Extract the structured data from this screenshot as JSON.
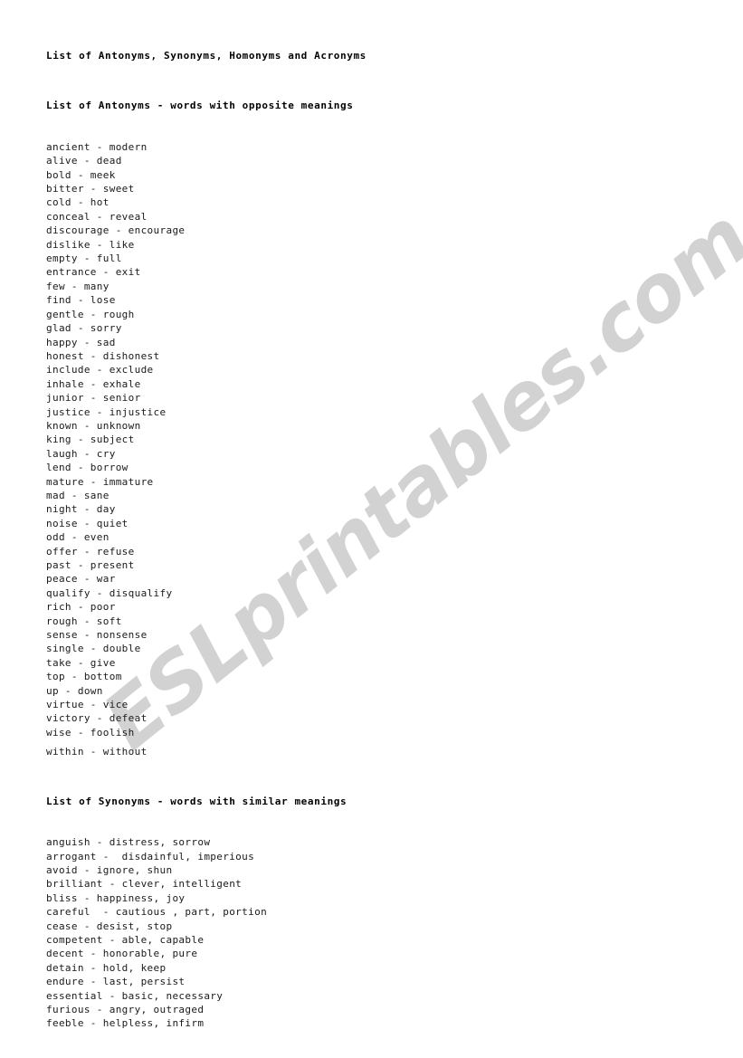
{
  "document": {
    "title": "List of Antonyms, Synonyms, Homonyms and Acronyms",
    "watermark": "ESLprintables.com",
    "colors": {
      "background": "#ffffff",
      "text": "#1a1a1a",
      "heading": "#000000",
      "watermark": "#d2d2d2"
    }
  },
  "sections": [
    {
      "heading": "List of Antonyms - words with opposite meanings",
      "entries": [
        "ancient - modern",
        "alive - dead",
        "bold - meek",
        "bitter - sweet",
        "cold - hot",
        "conceal - reveal",
        "discourage - encourage",
        "dislike - like",
        "empty - full",
        "entrance - exit",
        "few - many",
        "find - lose",
        "gentle - rough",
        "glad - sorry",
        "happy - sad",
        "honest - dishonest",
        "include - exclude",
        "inhale - exhale",
        "junior - senior",
        "justice - injustice",
        "known - unknown",
        "king - subject",
        "laugh - cry",
        "lend - borrow",
        "mature - immature",
        "mad - sane",
        "night - day",
        "noise - quiet",
        "odd - even",
        "offer - refuse",
        "past - present",
        "peace - war",
        "qualify - disqualify",
        "rich - poor",
        "rough - soft",
        "sense - nonsense",
        "single - double",
        "take - give",
        "top - bottom",
        "up - down",
        "virtue - vice",
        "victory - defeat",
        "wise - foolish",
        "within - without"
      ],
      "spaced_before_index": 43
    },
    {
      "heading": "List of Synonyms - words with similar meanings",
      "entries": [
        "anguish - distress, sorrow",
        "arrogant -  disdainful, imperious",
        "avoid - ignore, shun",
        "brilliant - clever, intelligent",
        "bliss - happiness, joy",
        "careful  - cautious , part, portion",
        "cease - desist, stop",
        "competent - able, capable",
        "decent - honorable, pure",
        "detain - hold, keep",
        "endure - last, persist",
        "essential - basic, necessary",
        "furious - angry, outraged",
        "feeble - helpless, infirm"
      ],
      "spaced_before_index": -1
    }
  ]
}
